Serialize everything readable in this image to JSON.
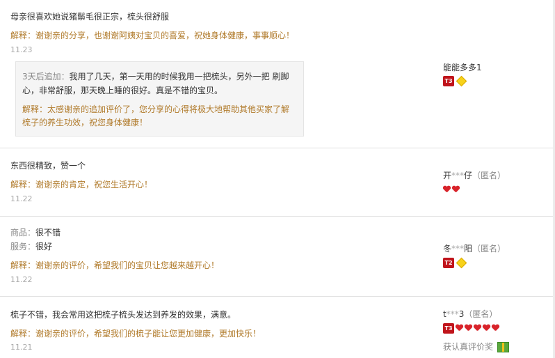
{
  "reviews": [
    {
      "content": "母亲很喜欢她说猪鬃毛很正宗，梳头很舒服",
      "explanation": "解释：谢谢亲的分享，也谢谢阿姨对宝贝的喜爱，祝她身体健康，事事顺心！",
      "date": "11.23",
      "followup": {
        "label": "3天后追加：",
        "line1": "我用了几天，第一天用的时候我用一把梳头，另外一把 刷脚",
        "line2": "心，非常舒服，那天晚上睡的很好。真是不错的宝贝。",
        "explain_line1": "解释：太感谢亲的追加评价了，您分享的心得将极大地帮助其他买家了解",
        "explain_line2": "梳子的养生功效，祝您身体健康！"
      },
      "user": {
        "name": "能能多多1",
        "anon": "",
        "level": "T3",
        "badges": [
          "yellow-diamond"
        ]
      }
    },
    {
      "content": "东西很精致，赞一个",
      "explanation": "解释：谢谢亲的肯定，祝您生活开心！",
      "date": "11.22",
      "user": {
        "name_start": "开",
        "stars": "***",
        "name_end": "仔",
        "anon": "（匿名）",
        "badges": [
          "red-heart",
          "red-heart"
        ]
      }
    },
    {
      "goods_label": "商品：",
      "goods_value": "很不错",
      "service_label": "服务：",
      "service_value": "很好",
      "explanation": "解释：谢谢亲的评价，希望我们的宝贝让您越来越开心！",
      "date": "11.22",
      "user": {
        "name_start": "冬",
        "stars": "***",
        "name_end": "阳",
        "anon": "（匿名）",
        "level": "T2",
        "badges": [
          "yellow-diamond"
        ]
      }
    },
    {
      "content": "梳子不错，我会常用这把梳子梳头发达到养发的效果，满意。",
      "explanation": "解释：谢谢亲的评价，希望我们的梳子能让您更加健康，更加快乐！",
      "date": "11.21",
      "user": {
        "name_start": "t",
        "stars": "***",
        "name_end": "3",
        "anon": "（匿名）",
        "level": "T3",
        "badges": [
          "red-heart",
          "red-heart",
          "red-heart",
          "red-heart",
          "red-heart"
        ]
      },
      "reward": "获认真评价奖"
    }
  ]
}
